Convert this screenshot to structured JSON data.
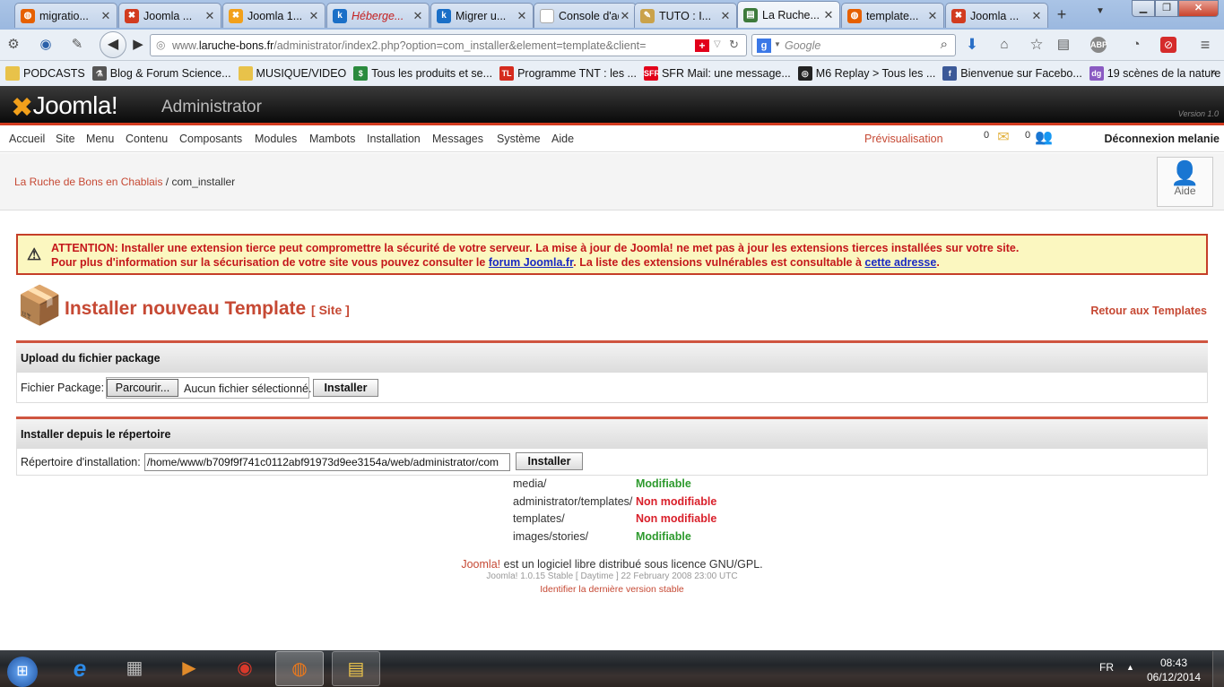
{
  "browser": {
    "tabs": [
      {
        "label": "migratio...",
        "icon": "firefox-icon",
        "color": "#e66000"
      },
      {
        "label": "Joomla ...",
        "icon": "joomla-icon",
        "color": "#d23b1f"
      },
      {
        "label": "Joomla 1...",
        "icon": "joomla-icon",
        "color": "#f2a01b"
      },
      {
        "label": "Héberge...",
        "icon": "k-icon",
        "color": "#1a6fc7"
      },
      {
        "label": "Migrer u...",
        "icon": "k-icon",
        "color": "#1a6fc7"
      },
      {
        "label": "Console d'ad...",
        "icon": "blank-icon",
        "color": "#ffffff"
      },
      {
        "label": "TUTO : I...",
        "icon": "pencil-icon",
        "color": "#caa24a"
      },
      {
        "label": "La Ruche...",
        "icon": "page-icon",
        "color": "#3d7a3b"
      },
      {
        "label": "template...",
        "icon": "firefox-icon",
        "color": "#e66000"
      },
      {
        "label": "Joomla ...",
        "icon": "joomla-icon",
        "color": "#d23b1f"
      }
    ],
    "active_tab_index": 7,
    "url_prefix": "www.",
    "url_domain": "laruche-bons.fr",
    "url_path": "/administrator/index2.php?option=com_installer&element=template&client=",
    "search_placeholder": "Google",
    "bookmarks": [
      {
        "label": "PODCASTS",
        "icon": "folder-icon",
        "color": "#e8c24a"
      },
      {
        "label": "Blog & Forum Science...",
        "icon": "science-icon",
        "color": "#555555"
      },
      {
        "label": "MUSIQUE/VIDEO",
        "icon": "folder-icon",
        "color": "#e8c24a"
      },
      {
        "label": "Tous les produits et se...",
        "icon": "shop-icon",
        "color": "#2a8a3e"
      },
      {
        "label": "Programme TNT : les ...",
        "icon": "tv-icon",
        "color": "#d52b1e"
      },
      {
        "label": "SFR Mail: une message...",
        "icon": "sfr-icon",
        "color": "#e2001a"
      },
      {
        "label": "M6 Replay > Tous les ...",
        "icon": "m6-icon",
        "color": "#222222"
      },
      {
        "label": "Bienvenue sur Facebo...",
        "icon": "facebook-icon",
        "color": "#3b5998"
      },
      {
        "label": "19 scènes de la nature ...",
        "icon": "dgt-icon",
        "color": "#8a5ac2"
      }
    ]
  },
  "joomla": {
    "logo_text": "Joomla!",
    "admin_label": "Administrator",
    "version_tag": "Version 1.0",
    "menu": [
      "Accueil",
      "Site",
      "Menu",
      "Contenu",
      "Composants",
      "Modules",
      "Mambots",
      "Installation",
      "Messages",
      "Système",
      "Aide"
    ],
    "preview_label": "Prévisualisation",
    "messages_count": "0",
    "users_count": "0",
    "logout_label": "Déconnexion melanie",
    "breadcrumb_site": "La Ruche de Bons en Chablais",
    "breadcrumb_sep": "/",
    "breadcrumb_page": "com_installer",
    "help_label": "Aide",
    "warning_line1": "ATTENTION: Installer une extension tierce peut compromettre la sécurité de votre serveur. La mise à jour de Joomla! ne met pas à jour les extensions tierces installées sur votre site.",
    "warning_line2_a": "Pour plus d'information sur la sécurisation de votre site vous pouvez consulter le ",
    "warning_link1": "forum Joomla.fr",
    "warning_line2_b": ". La liste des extensions vulnérables est consultable à ",
    "warning_link2": "cette adresse",
    "warning_line2_c": ".",
    "page_title": "Installer nouveau Template",
    "page_subtitle": "[ Site ]",
    "back_link": "Retour aux Templates",
    "upload_section_title": "Upload du fichier package",
    "package_label": "Fichier Package:",
    "browse_button": "Parcourir...",
    "no_file_text": "Aucun fichier sélectionné.",
    "install_button": "Installer",
    "dir_section_title": "Installer depuis le répertoire",
    "dir_label": "Répertoire d'installation:",
    "dir_value": "/home/www/b709f9f741c0112abf91973d9ee3154a/web/administrator/com",
    "dirs": [
      {
        "path": "media/",
        "status": "Modifiable",
        "writable": true
      },
      {
        "path": "administrator/templates/",
        "status": "Non modifiable",
        "writable": false
      },
      {
        "path": "templates/",
        "status": "Non modifiable",
        "writable": false
      },
      {
        "path": "images/stories/",
        "status": "Modifiable",
        "writable": true
      }
    ],
    "footer_brand": "Joomla!",
    "footer_text": " est un logiciel libre distribué sous licence GNU/GPL.",
    "footer_version": "Joomla! 1.0.15 Stable [ Daytime ] 22 February 2008 23:00 UTC",
    "footer_latest": "Identifier la dernière version stable"
  },
  "taskbar": {
    "lang": "FR",
    "time": "08:43",
    "date": "06/12/2014"
  },
  "colors": {
    "joomla_red": "#c64934",
    "writable_green": "#2e9a2e",
    "non_writable_red": "#d9202b"
  }
}
